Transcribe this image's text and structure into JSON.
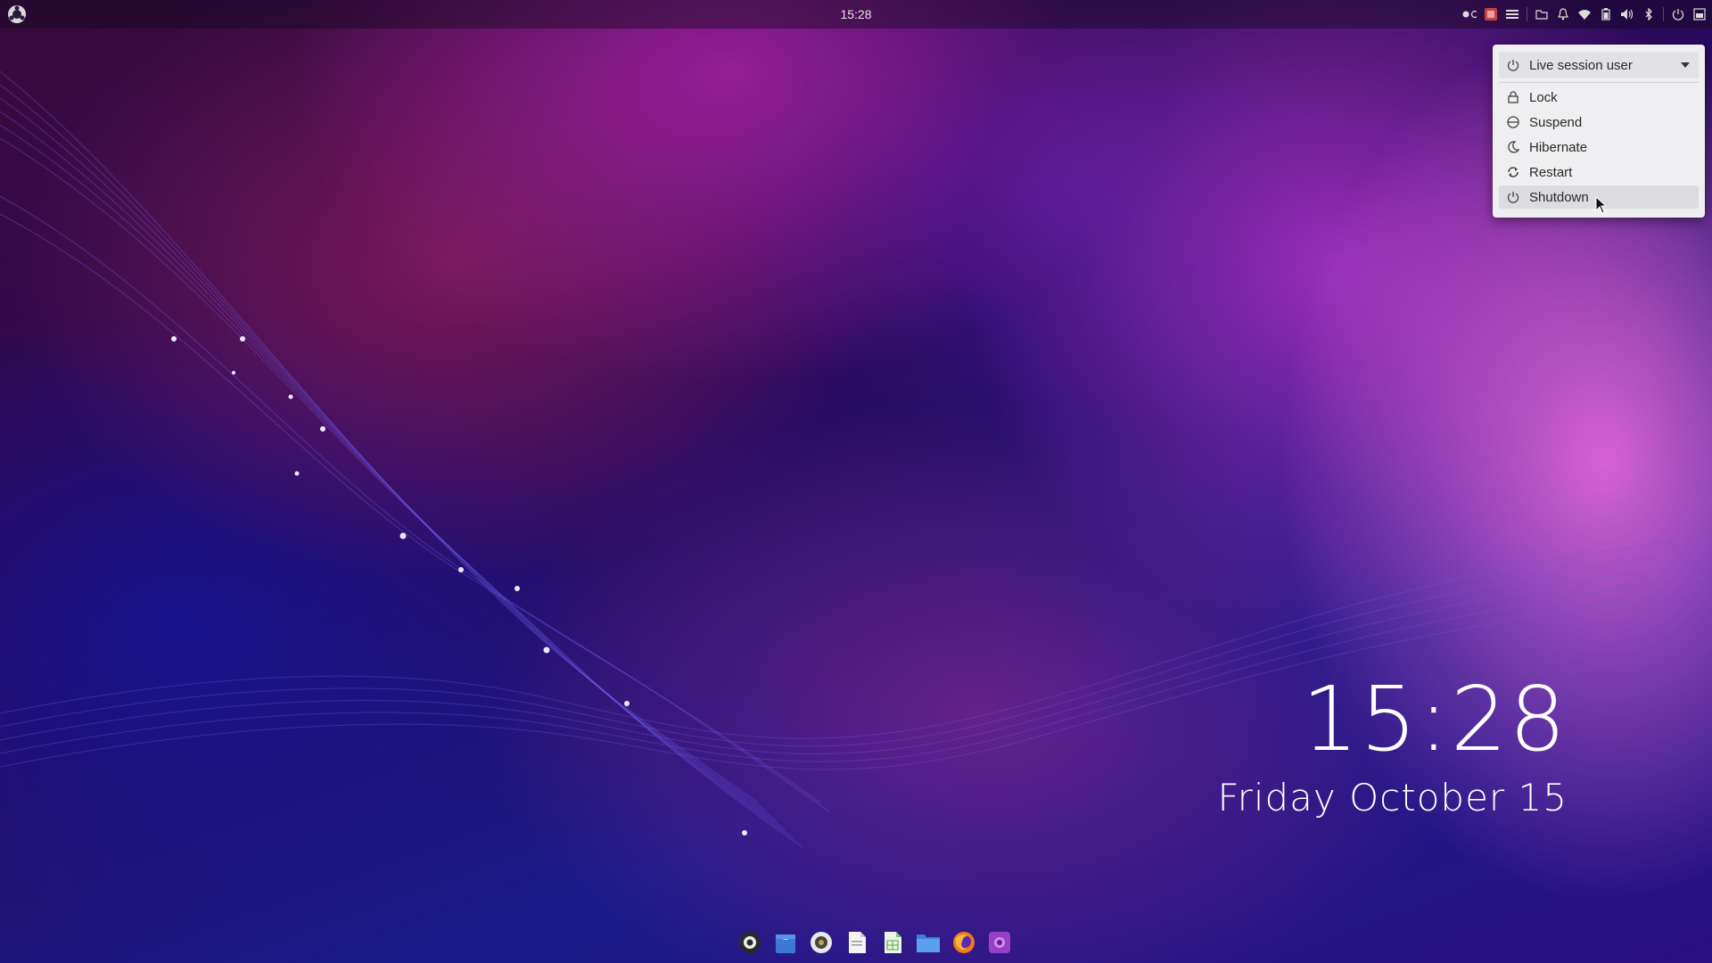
{
  "panel": {
    "clock": "15:28"
  },
  "tray": {
    "icons": [
      "record-indicator-icon",
      "app-indicator-icon",
      "menu-icon",
      "folder-icon",
      "bell-icon",
      "wifi-icon",
      "battery-icon",
      "volume-icon",
      "bluetooth-icon",
      "power-icon",
      "window-list-icon"
    ]
  },
  "power_menu": {
    "user_label": "Live session user",
    "items": [
      {
        "label": "Lock",
        "icon": "lock-icon"
      },
      {
        "label": "Suspend",
        "icon": "suspend-icon"
      },
      {
        "label": "Hibernate",
        "icon": "moon-icon"
      },
      {
        "label": "Restart",
        "icon": "restart-icon"
      },
      {
        "label": "Shutdown",
        "icon": "power-icon"
      }
    ],
    "selected": "Shutdown"
  },
  "desktop_clock": {
    "time": "15:28",
    "date": "Friday October 15"
  },
  "dock": {
    "apps": [
      "ubuntu-budgie-icon",
      "store-icon",
      "webcam-icon",
      "document-icon",
      "spreadsheet-icon",
      "files-icon",
      "firefox-icon",
      "screenshot-icon"
    ]
  },
  "colors": {
    "menu_bg": "#efeff1",
    "menu_selected": "#dcdce0",
    "panel_text": "#e6e6e6"
  }
}
